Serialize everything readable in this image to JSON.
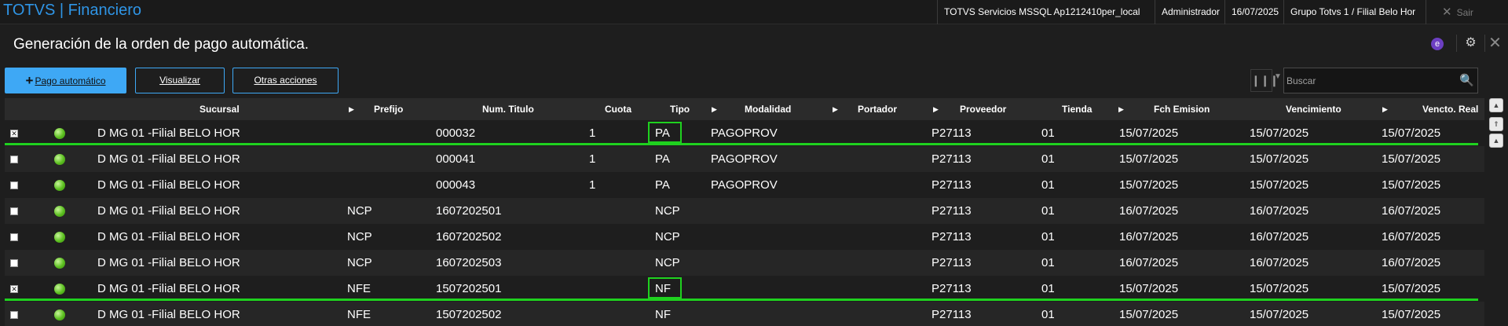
{
  "header": {
    "app_title": "TOTVS | Financiero",
    "server": "TOTVS Servicios MSSQL Ap1212410per_local",
    "user": "Administrador",
    "date": "16/07/2025",
    "branch": "Grupo Totvs 1 / Filial Belo Hor",
    "exit_label": "Sair"
  },
  "page": {
    "title": "Generación de la orden de pago automática."
  },
  "toolbar": {
    "pago_label": "Pago automático",
    "visualizar_label": "Visualizar",
    "otras_label": "Otras acciones",
    "search_placeholder": "Buscar"
  },
  "table": {
    "columns": [
      "Sucursal",
      "Prefijo",
      "Num. Titulo",
      "Cuota",
      "Tipo",
      "Modalidad",
      "Portador",
      "Proveedor",
      "Tienda",
      "Fch Emision",
      "Vencimiento",
      "Vencto. Real"
    ],
    "rows": [
      {
        "checked": true,
        "sucursal": "D MG 01 -Filial BELO HOR",
        "prefijo": "",
        "num": "000032",
        "cuota": "1",
        "tipo": "PA",
        "modalidad": "PAGOPROV",
        "portador": "",
        "proveedor": "P27113",
        "tienda": "01",
        "emision": "15/07/2025",
        "vencimiento": "15/07/2025",
        "vencto_real": "15/07/2025"
      },
      {
        "checked": false,
        "sucursal": "D MG 01 -Filial BELO HOR",
        "prefijo": "",
        "num": "000041",
        "cuota": "1",
        "tipo": "PA",
        "modalidad": "PAGOPROV",
        "portador": "",
        "proveedor": "P27113",
        "tienda": "01",
        "emision": "15/07/2025",
        "vencimiento": "15/07/2025",
        "vencto_real": "15/07/2025"
      },
      {
        "checked": false,
        "sucursal": "D MG 01 -Filial BELO HOR",
        "prefijo": "",
        "num": "000043",
        "cuota": "1",
        "tipo": "PA",
        "modalidad": "PAGOPROV",
        "portador": "",
        "proveedor": "P27113",
        "tienda": "01",
        "emision": "15/07/2025",
        "vencimiento": "15/07/2025",
        "vencto_real": "15/07/2025"
      },
      {
        "checked": false,
        "sucursal": "D MG 01 -Filial BELO HOR",
        "prefijo": "NCP",
        "num": "1607202501",
        "cuota": "",
        "tipo": "NCP",
        "modalidad": "",
        "portador": "",
        "proveedor": "P27113",
        "tienda": "01",
        "emision": "16/07/2025",
        "vencimiento": "16/07/2025",
        "vencto_real": "16/07/2025"
      },
      {
        "checked": false,
        "sucursal": "D MG 01 -Filial BELO HOR",
        "prefijo": "NCP",
        "num": "1607202502",
        "cuota": "",
        "tipo": "NCP",
        "modalidad": "",
        "portador": "",
        "proveedor": "P27113",
        "tienda": "01",
        "emision": "16/07/2025",
        "vencimiento": "16/07/2025",
        "vencto_real": "16/07/2025"
      },
      {
        "checked": false,
        "sucursal": "D MG 01 -Filial BELO HOR",
        "prefijo": "NCP",
        "num": "1607202503",
        "cuota": "",
        "tipo": "NCP",
        "modalidad": "",
        "portador": "",
        "proveedor": "P27113",
        "tienda": "01",
        "emision": "16/07/2025",
        "vencimiento": "16/07/2025",
        "vencto_real": "16/07/2025"
      },
      {
        "checked": true,
        "sucursal": "D MG 01 -Filial BELO HOR",
        "prefijo": "NFE",
        "num": "1507202501",
        "cuota": "",
        "tipo": "NF",
        "modalidad": "",
        "portador": "",
        "proveedor": "P27113",
        "tienda": "01",
        "emision": "15/07/2025",
        "vencimiento": "15/07/2025",
        "vencto_real": "15/07/2025"
      },
      {
        "checked": false,
        "sucursal": "D MG 01 -Filial BELO HOR",
        "prefijo": "NFE",
        "num": "1507202502",
        "cuota": "",
        "tipo": "NF",
        "modalidad": "",
        "portador": "",
        "proveedor": "P27113",
        "tienda": "01",
        "emision": "15/07/2025",
        "vencimiento": "15/07/2025",
        "vencto_real": "15/07/2025"
      }
    ]
  },
  "colors": {
    "accent": "#3ea8f5",
    "title_blue": "#2f95e6",
    "highlight": "#1fd11f",
    "status_green": "#5bbf1f"
  }
}
